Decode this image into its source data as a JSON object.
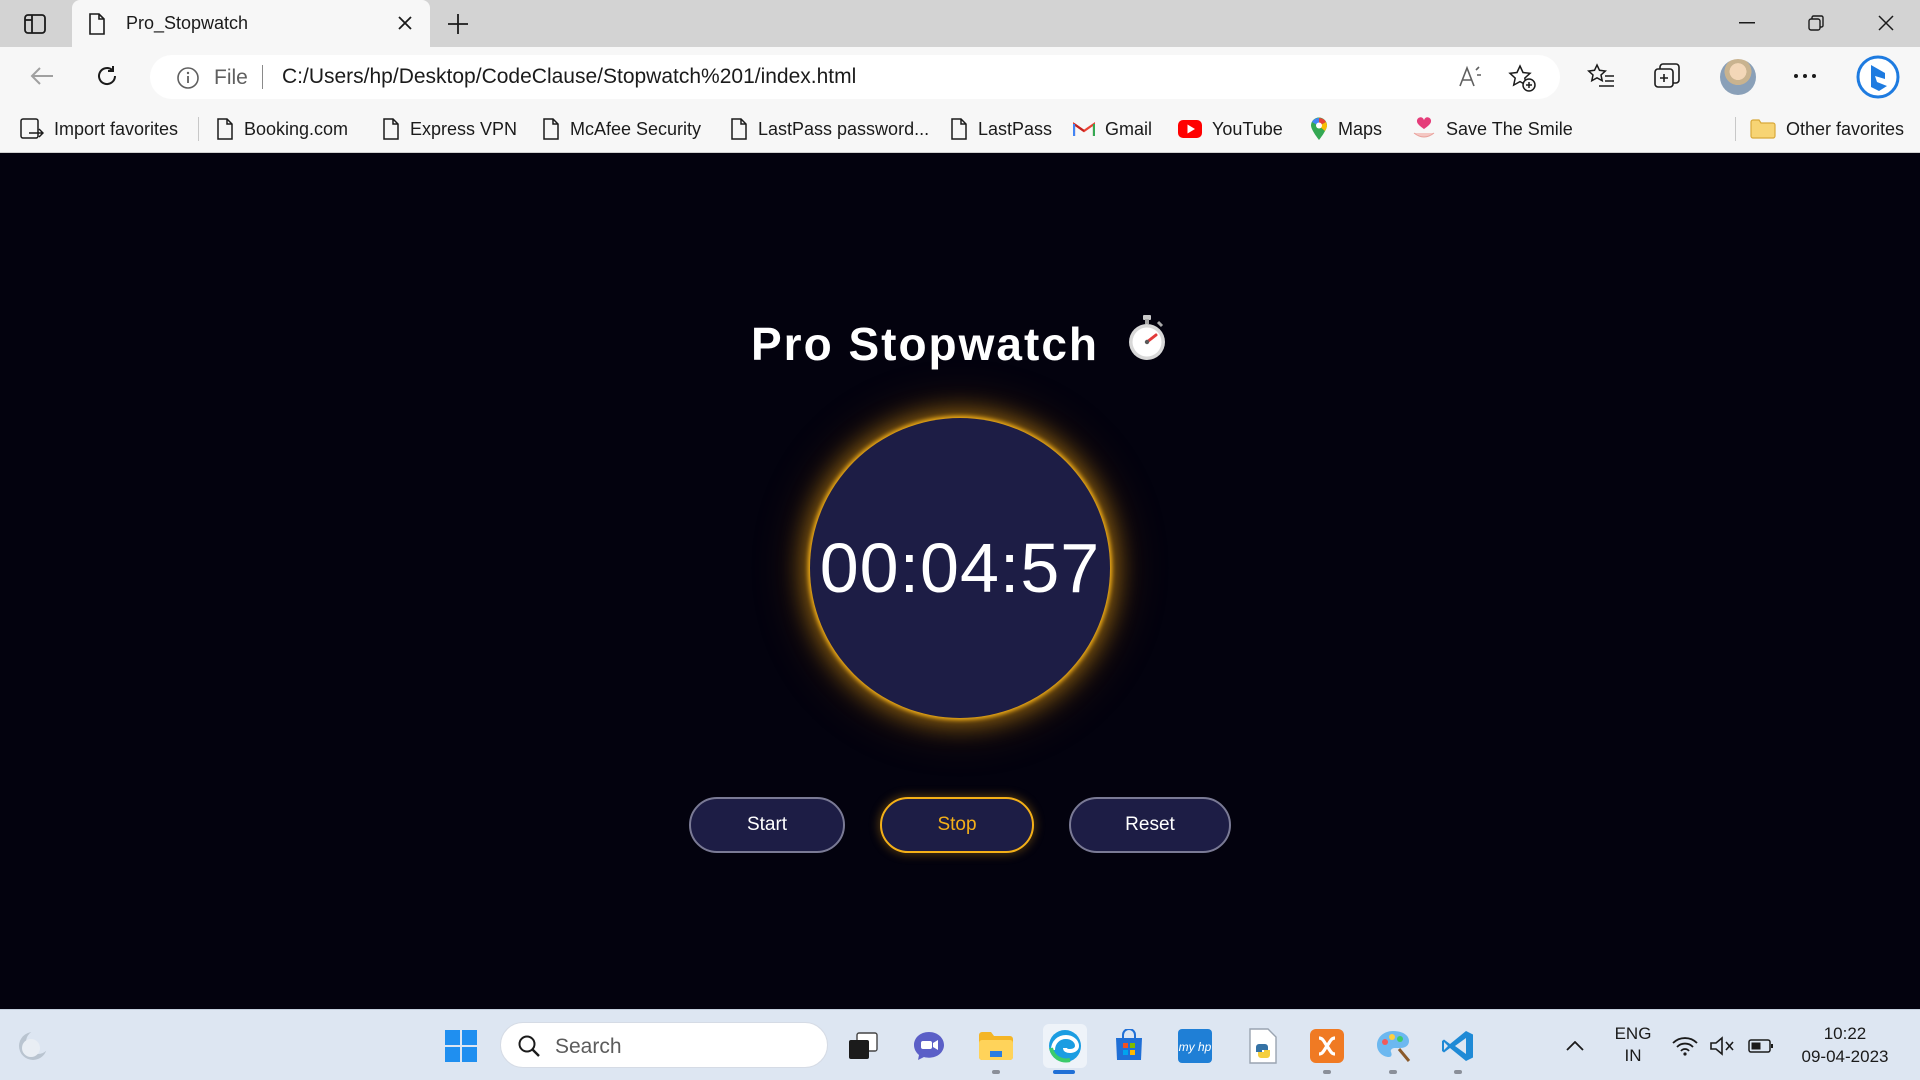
{
  "browser": {
    "tab_title": "Pro_Stopwatch",
    "address": {
      "protocol_label": "File",
      "url": "C:/Users/hp/Desktop/CodeClause/Stopwatch%201/index.html"
    },
    "favorites": [
      {
        "label": "Import favorites",
        "icon": "import-favorites-icon"
      },
      {
        "label": "Booking.com",
        "icon": "page-icon"
      },
      {
        "label": "Express VPN",
        "icon": "page-icon"
      },
      {
        "label": "McAfee Security",
        "icon": "page-icon"
      },
      {
        "label": "LastPass password...",
        "icon": "page-icon"
      },
      {
        "label": "LastPass",
        "icon": "page-icon"
      },
      {
        "label": "Gmail",
        "icon": "gmail-icon"
      },
      {
        "label": "YouTube",
        "icon": "youtube-icon"
      },
      {
        "label": "Maps",
        "icon": "maps-icon"
      },
      {
        "label": "Save The Smile",
        "icon": "save-the-smile-icon"
      }
    ],
    "other_favorites": "Other favorites"
  },
  "app": {
    "title": "Pro Stopwatch",
    "title_emoji": "⏱️",
    "time": "00:04:57",
    "buttons": {
      "start": "Start",
      "stop": "Stop",
      "reset": "Reset"
    },
    "colors": {
      "background": "#03020e",
      "dial": "#1d1d45",
      "accent": "#f4b018"
    }
  },
  "taskbar": {
    "search_placeholder": "Search",
    "language": "ENG",
    "region": "IN",
    "time": "10:22",
    "date": "09-04-2023"
  }
}
